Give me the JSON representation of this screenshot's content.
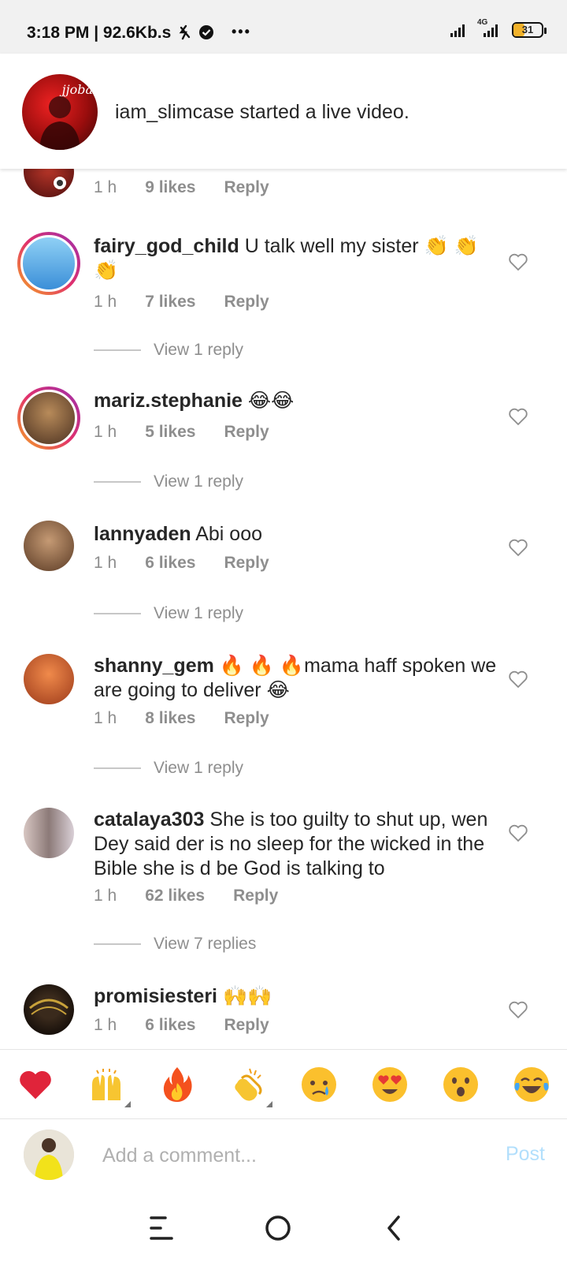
{
  "status_bar": {
    "time": "3:18 PM | 92.6Kb.s",
    "more": "•••",
    "network": "4G",
    "battery": "31"
  },
  "banner": {
    "avatar_logo": "jjoba",
    "text": "iam_slimcase started a live video."
  },
  "comments": [
    {
      "username": "",
      "text": "",
      "time": "1 h",
      "likes": "9 likes",
      "reply": "Reply"
    },
    {
      "username": "fairy_god_child",
      "text": " U talk well my sister 👏 👏 👏",
      "time": "1 h",
      "likes": "7 likes",
      "reply": "Reply",
      "view_replies": "View 1 reply"
    },
    {
      "username": "mariz.stephanie",
      "text": " 😂😂",
      "time": "1 h",
      "likes": "5 likes",
      "reply": "Reply",
      "view_replies": "View 1 reply"
    },
    {
      "username": "lannyaden",
      "text": " Abi ooo",
      "time": "1 h",
      "likes": "6 likes",
      "reply": "Reply",
      "view_replies": "View 1 reply"
    },
    {
      "username": "shanny_gem",
      "text": " 🔥 🔥 🔥mama haff spoken we are going to deliver 😂",
      "time": "1 h",
      "likes": "8 likes",
      "reply": "Reply",
      "view_replies": "View 1 reply"
    },
    {
      "username": "catalaya303",
      "text": " She is too guilty to shut up, wen Dey said der is no sleep for the wicked in the Bible she is d be God is talking to",
      "time": "1 h",
      "likes": "62 likes",
      "reply": "Reply",
      "view_replies": "View 7 replies"
    },
    {
      "username": "promisiesteri",
      "text": " 🙌🙌",
      "time": "1 h",
      "likes": "6 likes",
      "reply": "Reply"
    }
  ],
  "emoji_bar": [
    "❤️",
    "🙌",
    "🔥",
    "👏",
    "😢",
    "😍",
    "😮",
    "😂"
  ],
  "comment_input": {
    "placeholder": "Add a comment...",
    "post_label": "Post"
  },
  "colors": {
    "post_disabled": "#b2dffc",
    "muted_text": "#8e8e8e",
    "story_ring_start": "#f5a623",
    "story_ring_end": "#9b2fae"
  }
}
